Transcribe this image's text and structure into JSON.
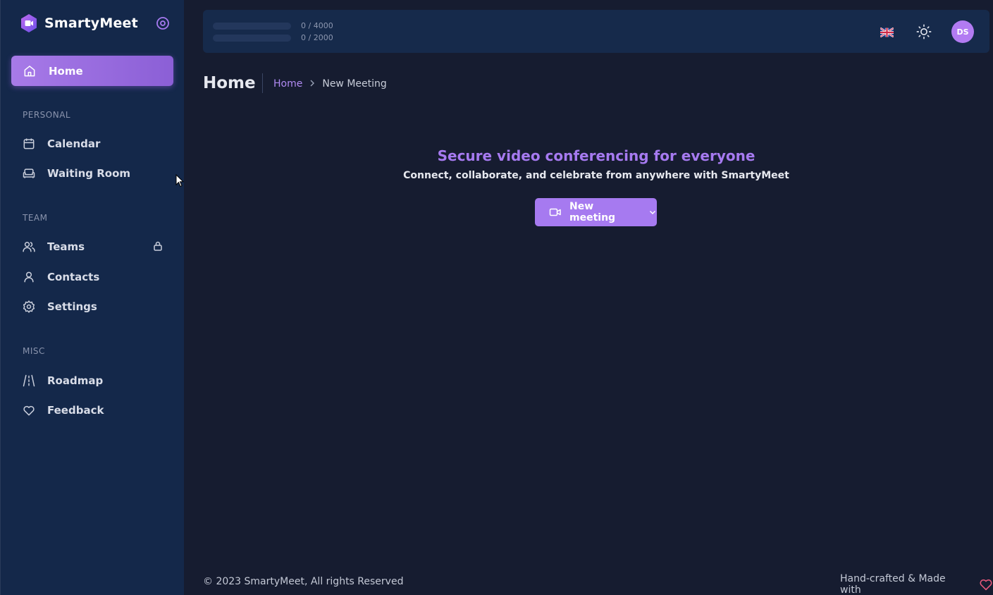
{
  "app": {
    "name": "SmartyMeet"
  },
  "sidebar": {
    "home": {
      "label": "Home",
      "icon": "home-icon"
    },
    "sections": [
      {
        "title": "PERSONAL",
        "items": [
          {
            "label": "Calendar",
            "icon": "calendar-icon"
          },
          {
            "label": "Waiting Room",
            "icon": "sofa-icon"
          }
        ]
      },
      {
        "title": "TEAM",
        "items": [
          {
            "label": "Teams",
            "icon": "users-icon",
            "locked": true
          },
          {
            "label": "Contacts",
            "icon": "user-icon"
          },
          {
            "label": "Settings",
            "icon": "gear-icon"
          }
        ]
      },
      {
        "title": "MISC",
        "items": [
          {
            "label": "Roadmap",
            "icon": "road-icon"
          },
          {
            "label": "Feedback",
            "icon": "heart-icon"
          }
        ]
      }
    ]
  },
  "topbar": {
    "usage": [
      {
        "text": "0 / 4000",
        "value": 0
      },
      {
        "text": "0 / 2000",
        "value": 0
      }
    ],
    "language_icon": "uk-flag-icon",
    "theme_icon": "sun-icon",
    "avatar_initials": "DS"
  },
  "header": {
    "title": "Home",
    "breadcrumb": {
      "home": "Home",
      "current": "New Meeting"
    }
  },
  "hero": {
    "title": "Secure video conferencing for everyone",
    "subtitle": "Connect, collaborate, and celebrate from anywhere with SmartyMeet",
    "button_label": "New meeting"
  },
  "footer": {
    "copyright": "© 2023 SmartyMeet, All rights Reserved",
    "made_with": "Hand-crafted & Made with"
  },
  "colors": {
    "accent": "#a67af0",
    "sidebar_bg": "#14284a",
    "page_bg": "#161c30",
    "heart": "#e4577a"
  }
}
